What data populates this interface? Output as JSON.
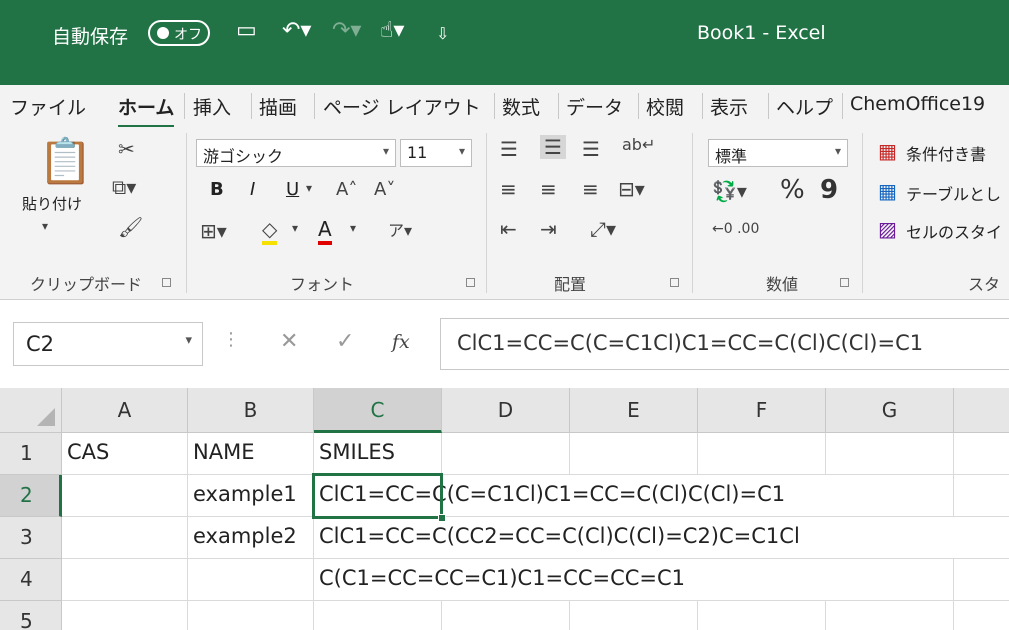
{
  "titlebar": {
    "autosave_label": "自動保存",
    "autosave_toggle": "オフ",
    "doc_title": "Book1  -  Excel"
  },
  "menu": {
    "tabs": [
      "ファイル",
      "ホーム",
      "挿入",
      "描画",
      "ページ レイアウト",
      "数式",
      "データ",
      "校閲",
      "表示",
      "ヘルプ",
      "ChemOffice19"
    ],
    "active": "ホーム"
  },
  "ribbon": {
    "clipboard": {
      "paste_label": "貼り付け",
      "group_label": "クリップボード"
    },
    "font": {
      "font_name": "游ゴシック",
      "font_size": "11",
      "group_label": "フォント"
    },
    "alignment": {
      "group_label": "配置"
    },
    "number": {
      "format": "標準",
      "percent": "%",
      "comma": "9",
      "group_label": "数値"
    },
    "styles": {
      "conditional": "条件付き書",
      "table": "テーブルとし",
      "cell_styles": "セルのスタイ",
      "group_label": "スタ"
    }
  },
  "formula_bar": {
    "name_box": "C2",
    "fx": "fx",
    "content": "ClC1=CC=C(C=C1Cl)C1=CC=C(Cl)C(Cl)=C1"
  },
  "sheet": {
    "columns": [
      "A",
      "B",
      "C",
      "D",
      "E",
      "F",
      "G"
    ],
    "rows": [
      "1",
      "2",
      "3",
      "4",
      "5"
    ],
    "cells": {
      "A1": "CAS",
      "B1": "NAME",
      "C1": "SMILES",
      "B2": "example1",
      "C2": "ClC1=CC=C(C=C1Cl)C1=CC=C(Cl)C(Cl)=C1",
      "B3": "example2",
      "C3": "ClC1=CC=C(CC2=CC=C(Cl)C(Cl)=C2)C=C1Cl",
      "C4": "C(C1=CC=CC=C1)C1=CC=CC=C1"
    },
    "active_cell": "C2"
  },
  "colors": {
    "excel_green": "#217346",
    "ribbon_bg": "#f3f3f3"
  }
}
